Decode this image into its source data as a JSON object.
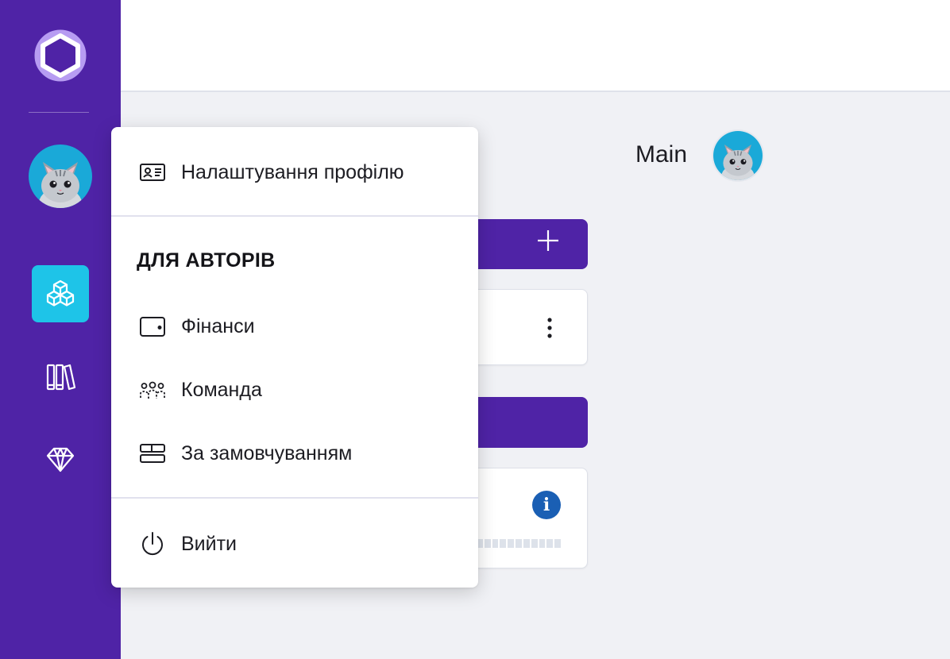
{
  "colors": {
    "sidebar": "#4f23a6",
    "active_nav": "#1ec4e8",
    "accent_button": "#4f23a6",
    "info_badge": "#1a5fb4",
    "content_bg": "#f0f1f5"
  },
  "sidebar": {
    "logo_icon": "hexagon-ring-logo",
    "avatar_icon": "cat-avatar",
    "nav": [
      {
        "icon": "cubes-icon",
        "active": true
      },
      {
        "icon": "library-books-icon",
        "active": false
      },
      {
        "icon": "diamond-icon",
        "active": false
      }
    ]
  },
  "main": {
    "title": "Main",
    "avatar_icon": "cat-avatar",
    "add_button_icon": "plus-icon",
    "card_menu_icon": "more-vertical-icon",
    "info_badge_text": "i"
  },
  "menu": {
    "profile_settings": "Налаштування профілю",
    "section_title": "ДЛЯ АВТОРІВ",
    "finances": "Фінанси",
    "team": "Команда",
    "default": "За замовчуванням",
    "logout": "Вийти"
  }
}
